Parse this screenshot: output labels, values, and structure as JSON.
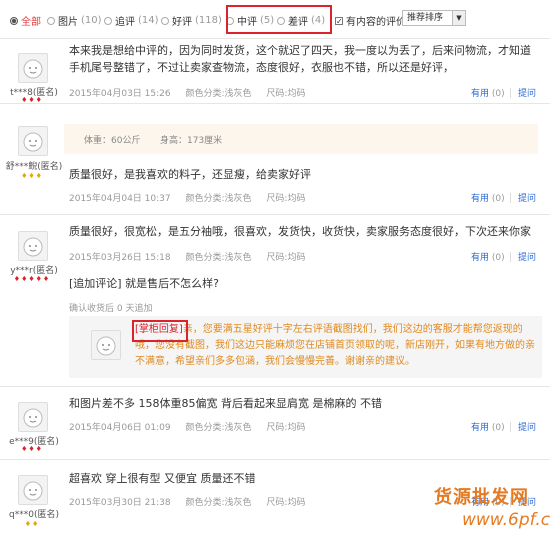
{
  "filters": {
    "all": {
      "label": "全部"
    },
    "pic": {
      "label": "图片",
      "count": "(10)"
    },
    "append": {
      "label": "追评",
      "count": "(14)"
    },
    "good": {
      "label": "好评",
      "count": "(118)"
    },
    "mid": {
      "label": "中评",
      "count": "(5)"
    },
    "bad": {
      "label": "差评",
      "count": "(4)"
    },
    "has_content": {
      "label": "有内容的评价",
      "checked": true
    },
    "sort": {
      "label": "推荐排序"
    }
  },
  "reviews": [
    {
      "user": "t***8(匿名)",
      "level": "red",
      "text": "本来我是想给中评的，因为同时发货，这个就迟了四天，我一度以为丢了，后来问物流，才知道手机尾号整错了，不过让卖家查物流，态度很好，衣服也不错，所以还是好评，",
      "date": "2015年04月03日 15:26",
      "color": "颜色分类:浅灰色",
      "size": "尺码:均码",
      "useful": "有用",
      "useful_count": "(0)",
      "reply": "提问"
    },
    {
      "user": "舒***鲵(匿名)",
      "level": "gold",
      "weight": "体重：60公斤",
      "height": "身高：173厘米",
      "text": "质量很好，是我喜欢的料子，还显瘦，给卖家好评",
      "date": "2015年04月04日 10:37",
      "color": "颜色分类:浅灰色",
      "size": "尺码:均码",
      "useful": "有用",
      "useful_count": "(0)",
      "reply": "提问"
    },
    {
      "user": "y***r(匿名)",
      "level": "red",
      "text": "质量很好，很宽松，是五分袖哦，很喜欢，发货快，收货快，卖家服务态度很好，下次还来你家",
      "date": "2015年03月26日 15:18",
      "color": "颜色分类:浅灰色",
      "size": "尺码:均码",
      "useful": "有用",
      "useful_count": "(0)",
      "reply": "提问",
      "append_text": "[追加评论] 就是售后不怎么样?",
      "append_meta": "确认收货后 0 天追加",
      "shop_reply_label": "[掌柜回复]",
      "shop_reply_text": "亲，您要满五星好评十字左右评语截图找们，我们这边的客服才能帮您返现的哦，您没有截图，我们这边只能麻烦您在店铺首页领取的呢，新店刚开，如果有地方做的亲不满意，希望亲们多多包涵，我们会慢慢完善。谢谢亲的建议。"
    },
    {
      "user": "e***9(匿名)",
      "level": "red",
      "text": "和图片差不多 158体重85偏宽 背后看起来显肩宽 是棉麻的 不错",
      "date": "2015年04月06日 01:09",
      "color": "颜色分类:浅灰色",
      "size": "尺码:均码",
      "useful": "有用",
      "useful_count": "(0)",
      "reply": "提问"
    },
    {
      "user": "q***0(匿名)",
      "level": "gold",
      "text": "超喜欢 穿上很有型 又便宜 质量还不错",
      "date": "2015年03月30日 21:38",
      "color": "颜色分类:浅灰色",
      "size": "尺码:均码",
      "useful": "有用",
      "useful_count": "(0)",
      "reply": "提问"
    }
  ],
  "watermark": {
    "line1": "货源批发网",
    "line2": "www.6pf.cn"
  },
  "colors": {
    "highlight_box": "#d9232d",
    "link": "#2b6ad4",
    "shop_reply": "#e08a1e"
  }
}
